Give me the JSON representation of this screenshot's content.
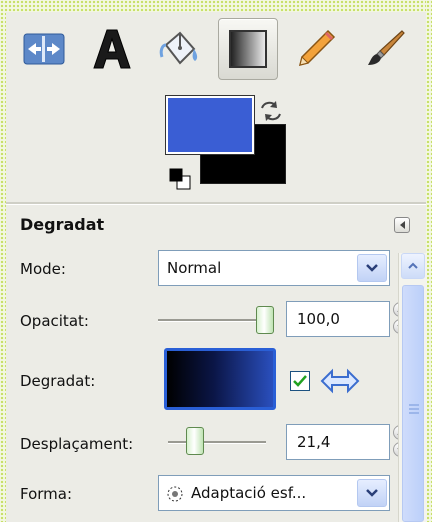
{
  "toolbox": {
    "tools": [
      {
        "name": "align-tool",
        "icon": "align-icon"
      },
      {
        "name": "text-tool",
        "icon": "text-icon"
      },
      {
        "name": "bucket-fill-tool",
        "icon": "bucket-fill-icon"
      },
      {
        "name": "blend-tool",
        "icon": "gradient-icon",
        "active": true
      },
      {
        "name": "pencil-tool",
        "icon": "pencil-icon"
      },
      {
        "name": "paintbrush-tool",
        "icon": "paintbrush-icon"
      }
    ],
    "foreground_color": "#3a5ed4",
    "background_color": "#000000"
  },
  "tool_options": {
    "title": "Degradat",
    "mode": {
      "label": "Mode:",
      "value": "Normal"
    },
    "opacity": {
      "label": "Opacitat:",
      "value": "100,0",
      "level_percent": 100
    },
    "gradient": {
      "label": "Degradat:",
      "reverse_checked": true
    },
    "offset": {
      "label": "Desplaçament:",
      "value": "21,4",
      "level_percent": 21.4
    },
    "shape": {
      "label": "Forma:",
      "value": "Adaptació esf..."
    }
  },
  "colors": {
    "accent": "#2a5fd6",
    "panel_bg": "#ecece6",
    "frame_dots": "#c8e06a"
  }
}
